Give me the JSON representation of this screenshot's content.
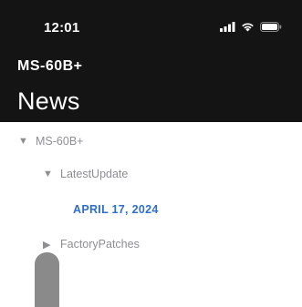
{
  "status_bar": {
    "time": "12:01",
    "icons": [
      "signal-icon",
      "wifi-icon",
      "battery-icon"
    ]
  },
  "header": {
    "device_name": "MS-60B+",
    "title": "News"
  },
  "tree": {
    "root": {
      "label": "MS-60B+",
      "expanded": true
    },
    "latest_update": {
      "label": "LatestUpdate",
      "expanded": true
    },
    "date_entry": {
      "label": "APRIL 17, 2024"
    },
    "factory_patches": {
      "label": "FactoryPatches",
      "expanded": false
    }
  },
  "colors": {
    "header_bg": "#141414",
    "link_blue": "#2d6fd0",
    "tree_gray": "#8e8e93"
  }
}
